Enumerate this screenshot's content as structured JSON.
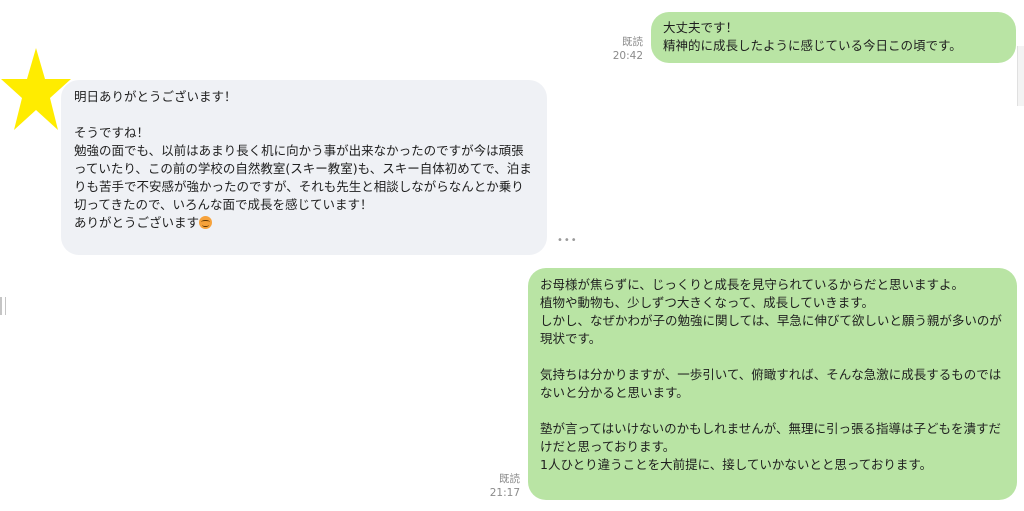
{
  "messages": [
    {
      "direction": "outgoing",
      "text": "大丈夫です！\n精神的に成長したように感じている今日この頃です。",
      "read_label": "既読",
      "time": "20:42"
    },
    {
      "direction": "incoming",
      "text": "明日ありがとうございます！\n\nそうですね！\n勉強の面でも、以前はあまり長く机に向かう事が出来なかったのですが今は頑張っていたり、この前の学校の自然教室(スキー教室)も、スキー自体初めてで、泊まりも苦手で不安感が強かったのですが、それも先生と相談しながらなんとか乗り切ってきたので、いろんな面で成長を感じています！\nありがとうございます",
      "emoji": "smiling-face-icon",
      "avatar": "star-icon"
    },
    {
      "direction": "outgoing",
      "text": "お母様が焦らずに、じっくりと成長を見守られているからだと思いますよ。\n植物や動物も、少しずつ大きくなって、成長していきます。\nしかし、なぜかわが子の勉強に関しては、早急に伸びて欲しいと願う親が多いのが現状です。\n\n気持ちは分かりますが、一歩引いて、俯瞰すれば、そんな急激に成長するものではないと分かると思います。\n\n塾が言ってはいけないのかもしれませんが、無理に引っ張る指導は子どもを潰すだけだと思っております。\n1人ひとり違うことを大前提に、接していかないとと思っております。",
      "read_label": "既読",
      "time": "21:17"
    }
  ],
  "colors": {
    "outgoing_bubble": "#b9e4a4",
    "incoming_bubble": "#eff1f5",
    "star": "#ffec00",
    "meta_text": "#8b8b8b"
  }
}
